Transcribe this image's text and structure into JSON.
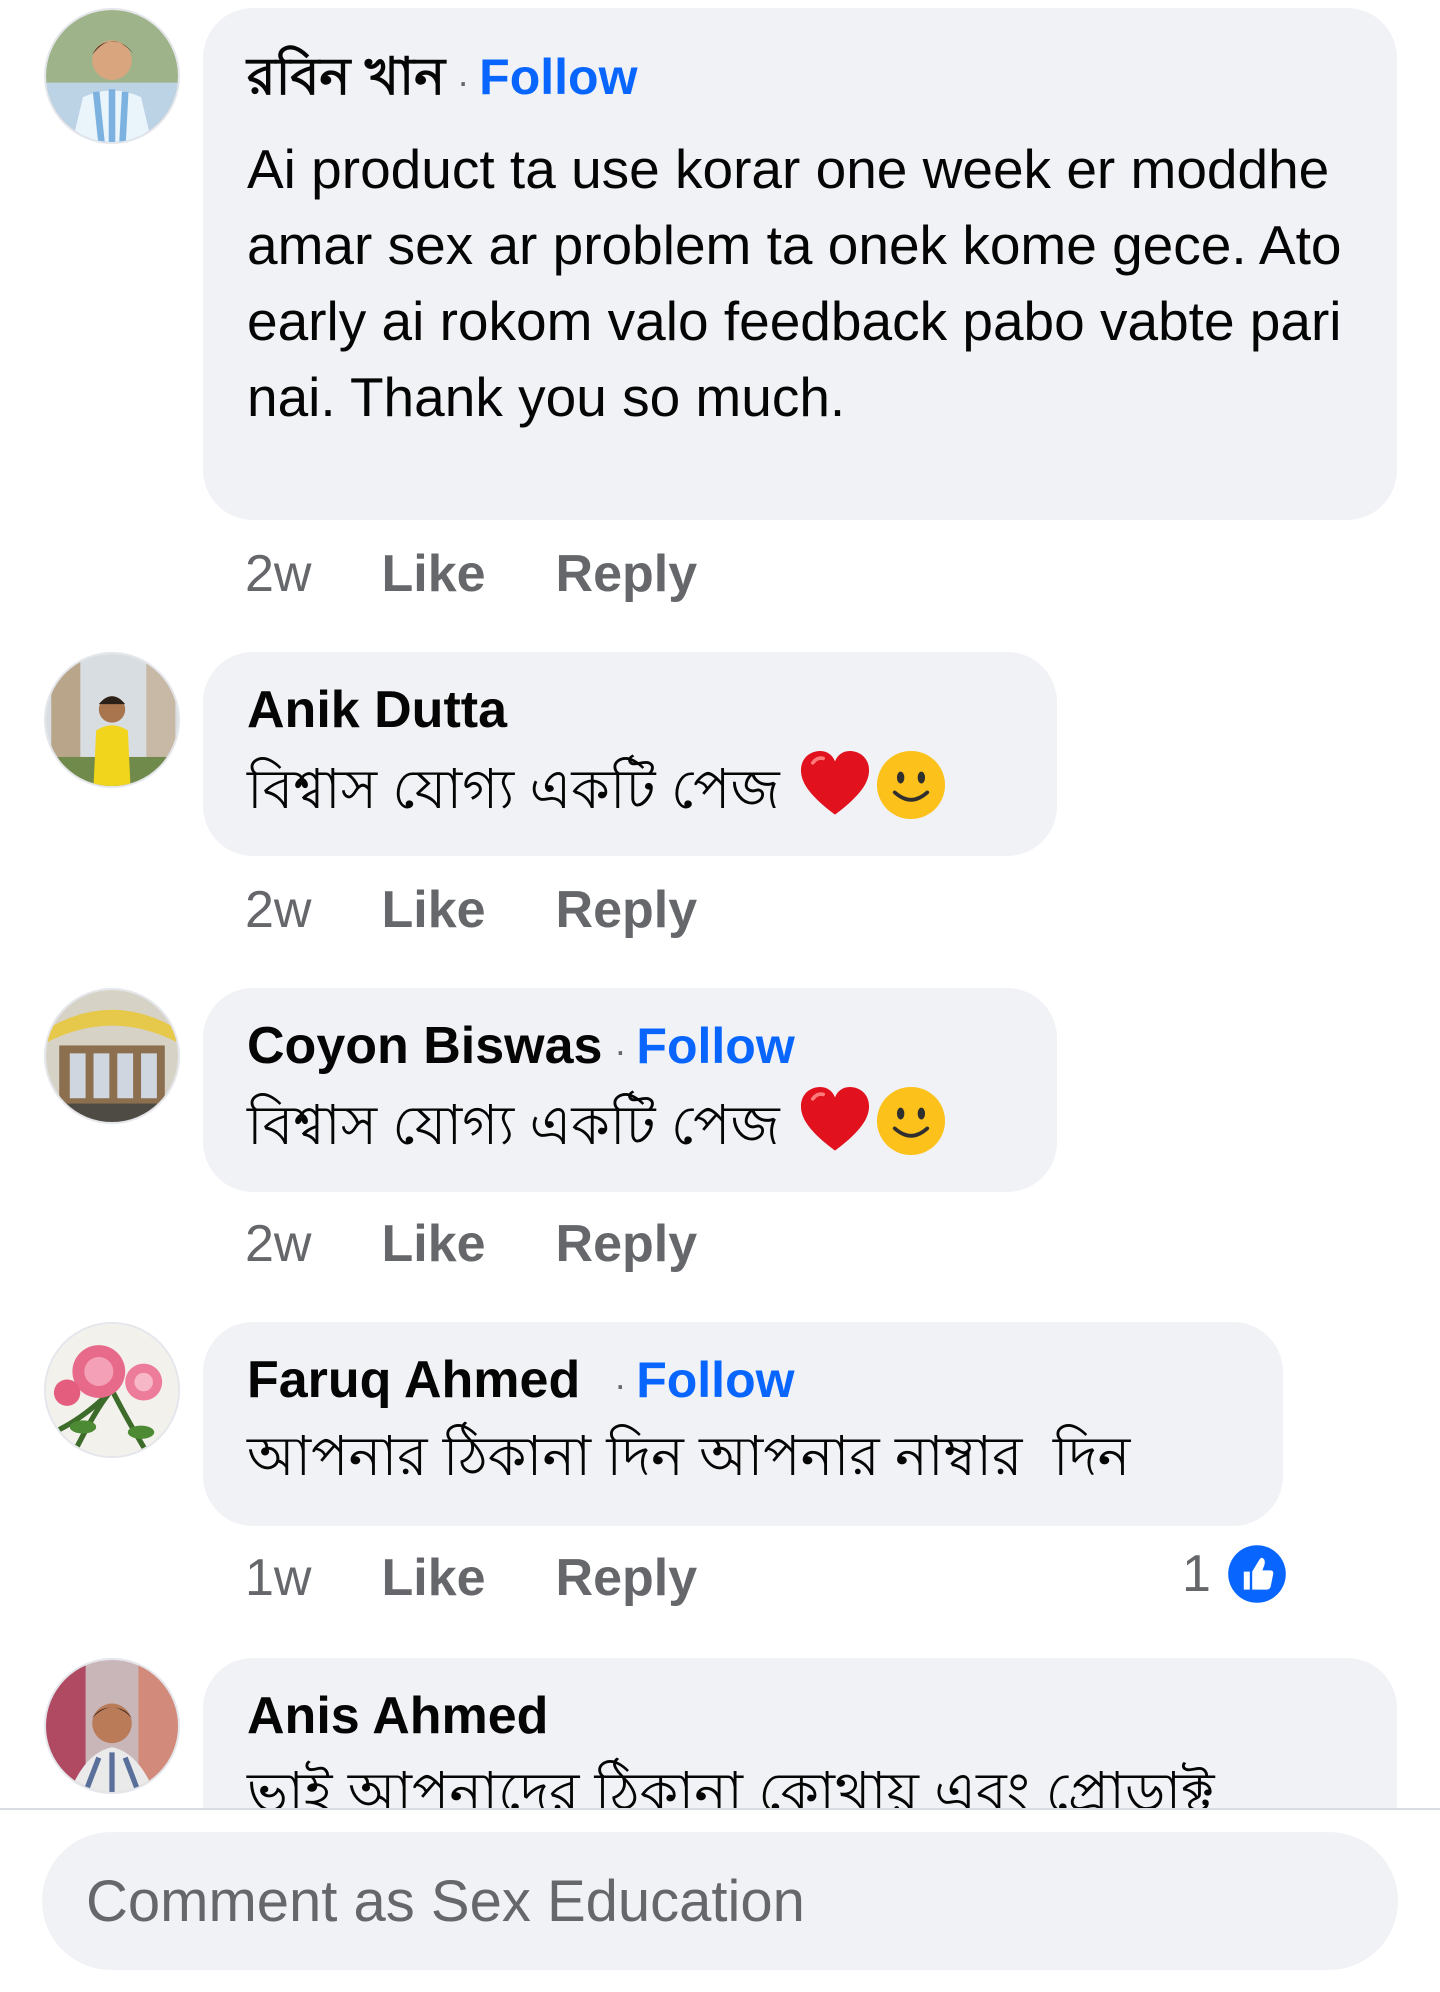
{
  "comments": [
    {
      "author": "রবিন খান",
      "follow": "Follow",
      "text": "Ai product ta use korar one week er moddhe amar sex ar problem ta onek kome gece. Ato early ai rokom valo feedback pabo vabte pari nai. Thank you so much.",
      "time": "2w",
      "like": "Like",
      "reply": "Reply"
    },
    {
      "author": "Anik Dutta",
      "text": "বিশ্বাস যোগ্য একটি পেজ",
      "emojis": [
        "red-heart",
        "smiling-face"
      ],
      "time": "2w",
      "like": "Like",
      "reply": "Reply"
    },
    {
      "author": "Coyon Biswas",
      "follow": "Follow",
      "text": "বিশ্বাস যোগ্য একটি পেজ",
      "emojis": [
        "red-heart",
        "smiling-face"
      ],
      "time": "2w",
      "like": "Like",
      "reply": "Reply"
    },
    {
      "author": "Faruq Ahmed",
      "follow": "Follow",
      "text": "আপনার ঠিকানা দিন আপনার নাম্বার  দিন",
      "time": "1w",
      "like": "Like",
      "reply": "Reply",
      "reaction_count": "1",
      "reaction_icon": "like-icon"
    },
    {
      "author": "Anis Ahmed",
      "text": "ভাই আপনাদের ঠিকানা কোথায় এবং প্রোডাক্ট"
    }
  ],
  "composer": {
    "placeholder": "Comment as Sex Education"
  },
  "colors": {
    "accent": "#0866ff",
    "bubble": "#f0f2f5",
    "secondary_text": "#65676b"
  }
}
